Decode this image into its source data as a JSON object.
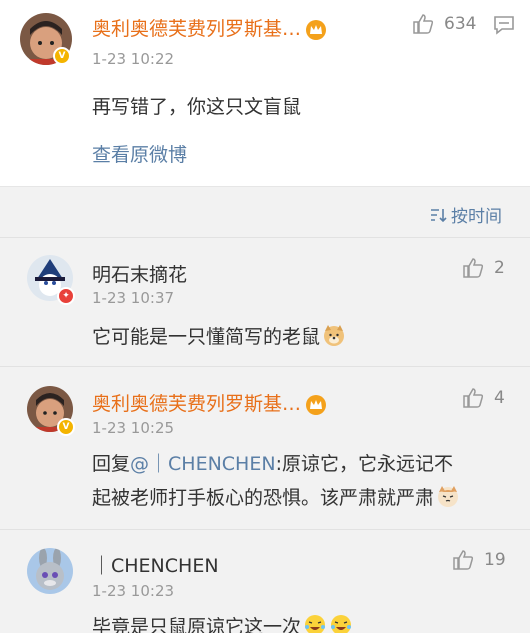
{
  "main": {
    "author": "奥利奥德芙费列罗斯基…",
    "time": "1-23 10:22",
    "text": "再写错了，你这只文盲鼠",
    "view_original": "查看原微博",
    "likes": "634"
  },
  "sort": {
    "label": "按时间"
  },
  "comments": [
    {
      "author": "明石末摘花",
      "time": "1-23 10:37",
      "text": "它可能是一只懂简写的老鼠",
      "likes": "2"
    },
    {
      "author": "奥利奥德芙费列罗斯基…",
      "time": "1-23 10:25",
      "reply_prefix": "回复",
      "mention": "@｜CHENCHEN",
      "text_line1": ":原谅它，它永远记不",
      "text_line2": "起被老师打手板心的恐惧。该严肃就严肃",
      "likes": "4"
    },
    {
      "author": "｜CHENCHEN",
      "time": "1-23 10:23",
      "text": "毕竟是只鼠原谅它这一次",
      "likes": "19"
    }
  ],
  "colors": {
    "accent": "#5b7fa6",
    "vip_name": "#e8701a",
    "badge_vip": "#f4b400",
    "badge_red": "#e8413a"
  }
}
